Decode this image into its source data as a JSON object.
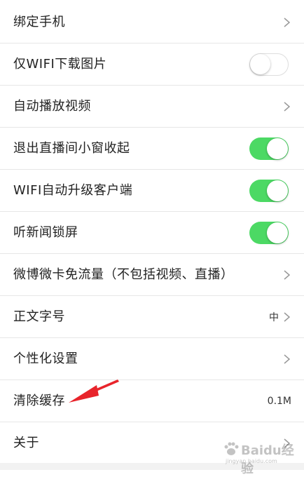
{
  "settings": {
    "items": [
      {
        "label": "绑定手机",
        "control": "chevron"
      },
      {
        "label": "仅WIFI下载图片",
        "control": "toggle",
        "toggle_on": false
      },
      {
        "label": "自动播放视频",
        "control": "chevron"
      },
      {
        "label": "退出直播间小窗收起",
        "control": "toggle",
        "toggle_on": true
      },
      {
        "label": "WIFI自动升级客户端",
        "control": "toggle",
        "toggle_on": true
      },
      {
        "label": "听新闻锁屏",
        "control": "toggle",
        "toggle_on": true
      },
      {
        "label": "微博微卡免流量（不包括视频、直播）",
        "control": "chevron"
      },
      {
        "label": "正文字号",
        "control": "chevron",
        "value": "中"
      },
      {
        "label": "个性化设置",
        "control": "chevron"
      },
      {
        "label": "清除缓存",
        "control": "value",
        "value": "0.1M"
      },
      {
        "label": "关于",
        "control": "chevron"
      }
    ]
  },
  "colors": {
    "toggle_on": "#4cd964",
    "annotation_arrow": "#e8242b",
    "divider": "#e6e6e6"
  },
  "annotation": {
    "icon": "red-arrow-icon",
    "points_to": "清除缓存"
  },
  "watermark": {
    "text": "Baidu经验",
    "subtext": "jingyan.baidu.com"
  }
}
